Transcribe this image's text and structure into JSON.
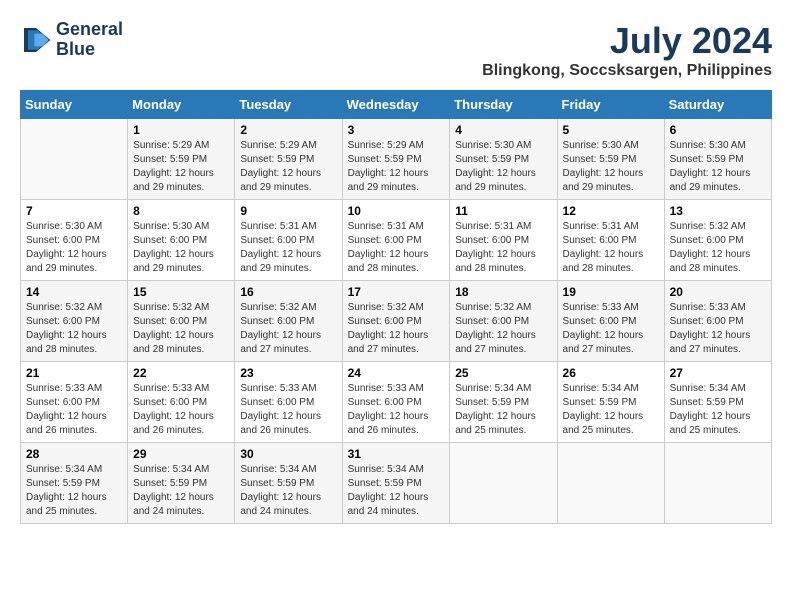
{
  "logo": {
    "line1": "General",
    "line2": "Blue"
  },
  "title": "July 2024",
  "subtitle": "Blingkong, Soccsksargen, Philippines",
  "days_header": [
    "Sunday",
    "Monday",
    "Tuesday",
    "Wednesday",
    "Thursday",
    "Friday",
    "Saturday"
  ],
  "weeks": [
    [
      {
        "day": "",
        "info": ""
      },
      {
        "day": "1",
        "info": "Sunrise: 5:29 AM\nSunset: 5:59 PM\nDaylight: 12 hours\nand 29 minutes."
      },
      {
        "day": "2",
        "info": "Sunrise: 5:29 AM\nSunset: 5:59 PM\nDaylight: 12 hours\nand 29 minutes."
      },
      {
        "day": "3",
        "info": "Sunrise: 5:29 AM\nSunset: 5:59 PM\nDaylight: 12 hours\nand 29 minutes."
      },
      {
        "day": "4",
        "info": "Sunrise: 5:30 AM\nSunset: 5:59 PM\nDaylight: 12 hours\nand 29 minutes."
      },
      {
        "day": "5",
        "info": "Sunrise: 5:30 AM\nSunset: 5:59 PM\nDaylight: 12 hours\nand 29 minutes."
      },
      {
        "day": "6",
        "info": "Sunrise: 5:30 AM\nSunset: 5:59 PM\nDaylight: 12 hours\nand 29 minutes."
      }
    ],
    [
      {
        "day": "7",
        "info": "Sunrise: 5:30 AM\nSunset: 6:00 PM\nDaylight: 12 hours\nand 29 minutes."
      },
      {
        "day": "8",
        "info": "Sunrise: 5:30 AM\nSunset: 6:00 PM\nDaylight: 12 hours\nand 29 minutes."
      },
      {
        "day": "9",
        "info": "Sunrise: 5:31 AM\nSunset: 6:00 PM\nDaylight: 12 hours\nand 29 minutes."
      },
      {
        "day": "10",
        "info": "Sunrise: 5:31 AM\nSunset: 6:00 PM\nDaylight: 12 hours\nand 28 minutes."
      },
      {
        "day": "11",
        "info": "Sunrise: 5:31 AM\nSunset: 6:00 PM\nDaylight: 12 hours\nand 28 minutes."
      },
      {
        "day": "12",
        "info": "Sunrise: 5:31 AM\nSunset: 6:00 PM\nDaylight: 12 hours\nand 28 minutes."
      },
      {
        "day": "13",
        "info": "Sunrise: 5:32 AM\nSunset: 6:00 PM\nDaylight: 12 hours\nand 28 minutes."
      }
    ],
    [
      {
        "day": "14",
        "info": "Sunrise: 5:32 AM\nSunset: 6:00 PM\nDaylight: 12 hours\nand 28 minutes."
      },
      {
        "day": "15",
        "info": "Sunrise: 5:32 AM\nSunset: 6:00 PM\nDaylight: 12 hours\nand 28 minutes."
      },
      {
        "day": "16",
        "info": "Sunrise: 5:32 AM\nSunset: 6:00 PM\nDaylight: 12 hours\nand 27 minutes."
      },
      {
        "day": "17",
        "info": "Sunrise: 5:32 AM\nSunset: 6:00 PM\nDaylight: 12 hours\nand 27 minutes."
      },
      {
        "day": "18",
        "info": "Sunrise: 5:32 AM\nSunset: 6:00 PM\nDaylight: 12 hours\nand 27 minutes."
      },
      {
        "day": "19",
        "info": "Sunrise: 5:33 AM\nSunset: 6:00 PM\nDaylight: 12 hours\nand 27 minutes."
      },
      {
        "day": "20",
        "info": "Sunrise: 5:33 AM\nSunset: 6:00 PM\nDaylight: 12 hours\nand 27 minutes."
      }
    ],
    [
      {
        "day": "21",
        "info": "Sunrise: 5:33 AM\nSunset: 6:00 PM\nDaylight: 12 hours\nand 26 minutes."
      },
      {
        "day": "22",
        "info": "Sunrise: 5:33 AM\nSunset: 6:00 PM\nDaylight: 12 hours\nand 26 minutes."
      },
      {
        "day": "23",
        "info": "Sunrise: 5:33 AM\nSunset: 6:00 PM\nDaylight: 12 hours\nand 26 minutes."
      },
      {
        "day": "24",
        "info": "Sunrise: 5:33 AM\nSunset: 6:00 PM\nDaylight: 12 hours\nand 26 minutes."
      },
      {
        "day": "25",
        "info": "Sunrise: 5:34 AM\nSunset: 5:59 PM\nDaylight: 12 hours\nand 25 minutes."
      },
      {
        "day": "26",
        "info": "Sunrise: 5:34 AM\nSunset: 5:59 PM\nDaylight: 12 hours\nand 25 minutes."
      },
      {
        "day": "27",
        "info": "Sunrise: 5:34 AM\nSunset: 5:59 PM\nDaylight: 12 hours\nand 25 minutes."
      }
    ],
    [
      {
        "day": "28",
        "info": "Sunrise: 5:34 AM\nSunset: 5:59 PM\nDaylight: 12 hours\nand 25 minutes."
      },
      {
        "day": "29",
        "info": "Sunrise: 5:34 AM\nSunset: 5:59 PM\nDaylight: 12 hours\nand 24 minutes."
      },
      {
        "day": "30",
        "info": "Sunrise: 5:34 AM\nSunset: 5:59 PM\nDaylight: 12 hours\nand 24 minutes."
      },
      {
        "day": "31",
        "info": "Sunrise: 5:34 AM\nSunset: 5:59 PM\nDaylight: 12 hours\nand 24 minutes."
      },
      {
        "day": "",
        "info": ""
      },
      {
        "day": "",
        "info": ""
      },
      {
        "day": "",
        "info": ""
      }
    ]
  ]
}
